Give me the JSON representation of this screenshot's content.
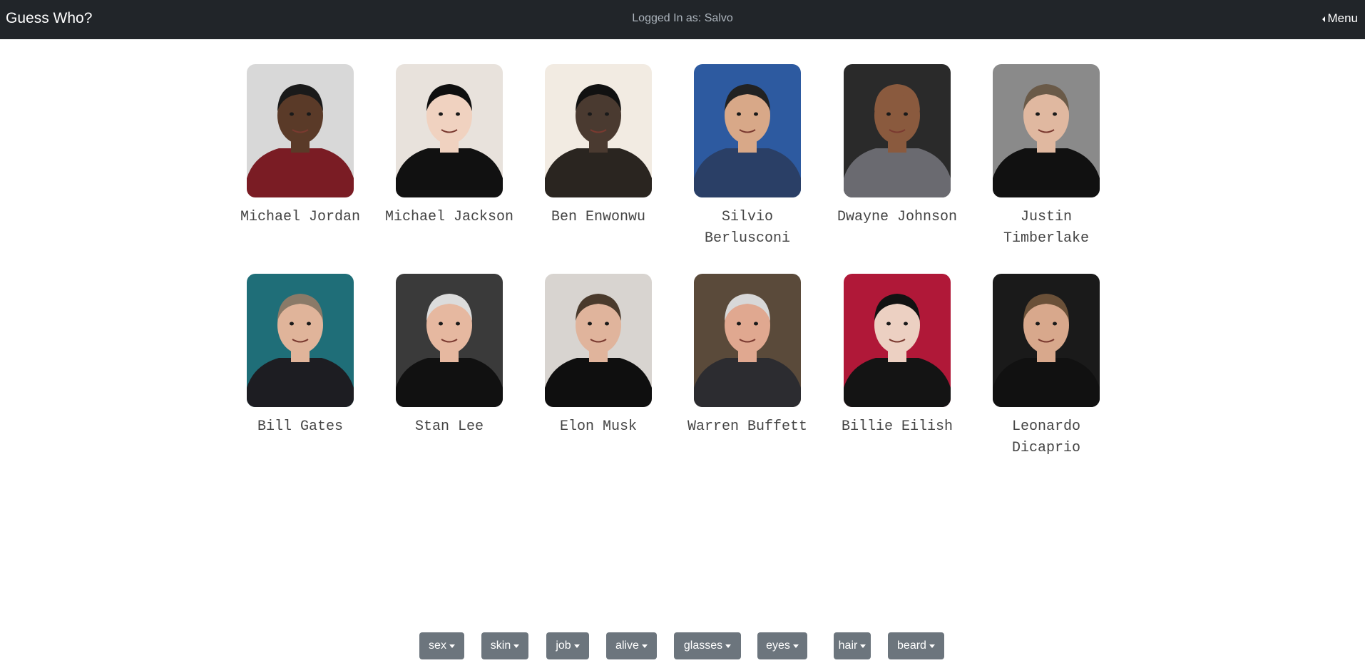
{
  "navbar": {
    "brand": "Guess Who?",
    "logged_in": "Logged In as: Salvo",
    "menu_label": "Menu"
  },
  "characters": [
    {
      "name": "Michael Jordan",
      "bg": "#d8d8d8",
      "skin": "#5a3a28",
      "hair": "#1a1a1a",
      "cloth": "#7a1c24"
    },
    {
      "name": "Michael Jackson",
      "bg": "#e8e2dc",
      "skin": "#f0d2c0",
      "hair": "#0f0f0f",
      "cloth": "#111111"
    },
    {
      "name": "Ben Enwonwu",
      "bg": "#f2ebe2",
      "skin": "#4a3a30",
      "hair": "#111111",
      "cloth": "#2a2520"
    },
    {
      "name": "Silvio Berlusconi",
      "bg": "#2d5aa0",
      "skin": "#d8a888",
      "hair": "#222222",
      "cloth": "#2a3f66"
    },
    {
      "name": "Dwayne Johnson",
      "bg": "#2a2a2a",
      "skin": "#8a5a3e",
      "hair": "#8a5a3e",
      "cloth": "#6a6a70"
    },
    {
      "name": "Justin Timberlake",
      "bg": "#8a8a8a",
      "skin": "#e0b8a0",
      "hair": "#6a5a48",
      "cloth": "#111111"
    },
    {
      "name": "Bill Gates",
      "bg": "#1f6e78",
      "skin": "#e0b49a",
      "hair": "#8a7a68",
      "cloth": "#1d1d22"
    },
    {
      "name": "Stan Lee",
      "bg": "#3a3a3a",
      "skin": "#e6b8a0",
      "hair": "#dcdcdc",
      "cloth": "#111111"
    },
    {
      "name": "Elon Musk",
      "bg": "#d8d4d0",
      "skin": "#e0b49c",
      "hair": "#4a3a2c",
      "cloth": "#0f0f0f"
    },
    {
      "name": "Warren Buffett",
      "bg": "#5a4a3a",
      "skin": "#e0a890",
      "hair": "#d8d8d8",
      "cloth": "#2c2c30"
    },
    {
      "name": "Billie Eilish",
      "bg": "#b01838",
      "skin": "#ecd0c2",
      "hair": "#121212",
      "cloth": "#141414"
    },
    {
      "name": "Leonardo Dicaprio",
      "bg": "#1a1a1a",
      "skin": "#d8a88c",
      "hair": "#6a5038",
      "cloth": "#111111"
    }
  ],
  "name_lines": [
    [
      "Michael Jordan"
    ],
    [
      "Michael Jackson"
    ],
    [
      "Ben Enwonwu"
    ],
    [
      "Silvio",
      "Berlusconi"
    ],
    [
      "Dwayne Johnson"
    ],
    [
      "Justin",
      "Timberlake"
    ],
    [
      "Bill Gates"
    ],
    [
      "Stan Lee"
    ],
    [
      "Elon Musk"
    ],
    [
      "Warren Buffett"
    ],
    [
      "Billie Eilish"
    ],
    [
      "Leonardo",
      "Dicaprio"
    ]
  ],
  "filters": [
    "sex",
    "skin",
    "job",
    "alive",
    "glasses",
    "eyes",
    "hair",
    "beard"
  ],
  "colors": {
    "navbar": "#212529",
    "filter_button": "#6c757d",
    "name_text": "#444444"
  }
}
